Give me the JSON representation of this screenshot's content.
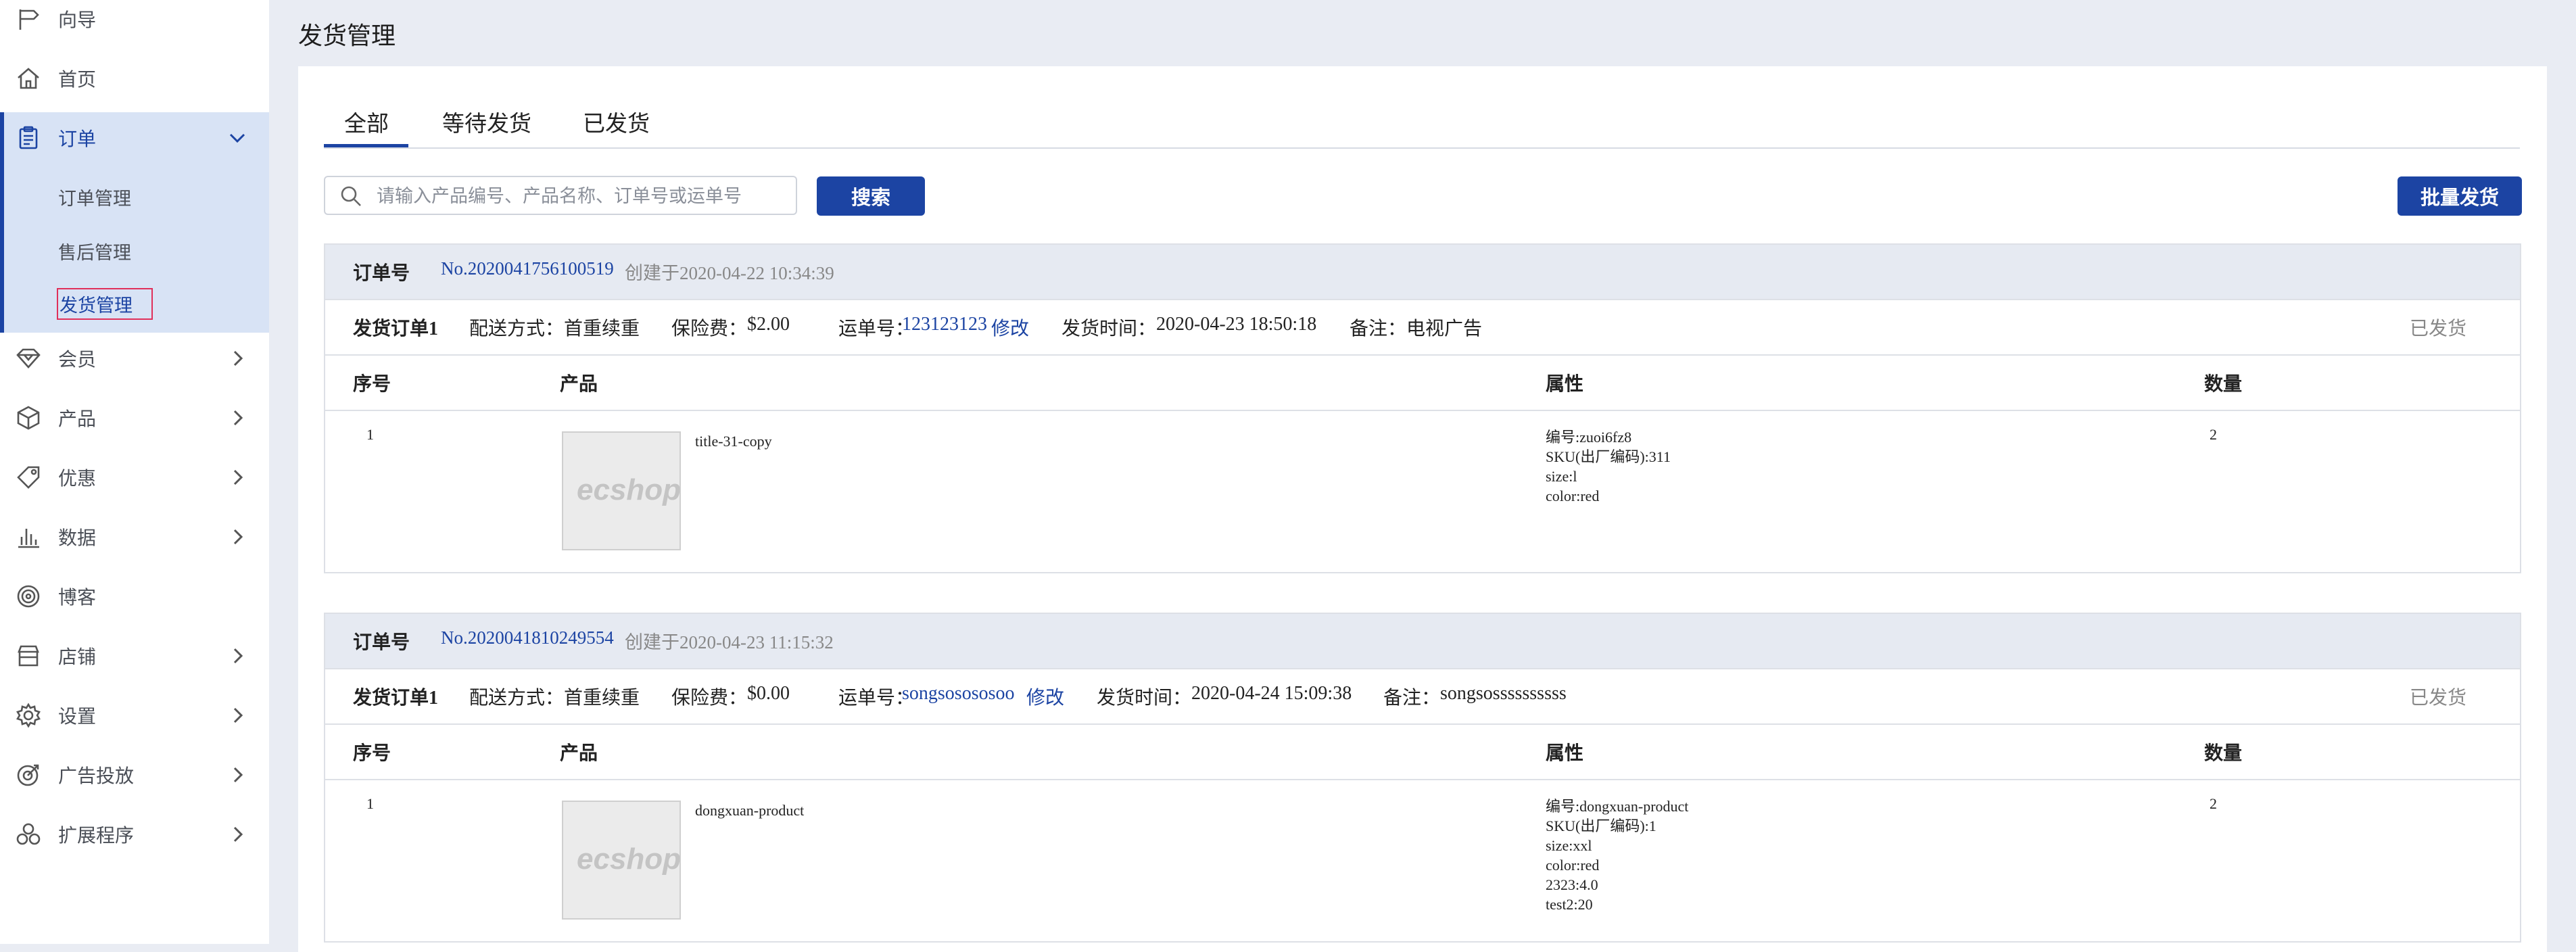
{
  "sidebar": {
    "items": [
      {
        "label": "向导",
        "icon": "signpost-icon"
      },
      {
        "label": "首页",
        "icon": "home-icon"
      },
      {
        "label": "订单",
        "icon": "clipboard-icon"
      },
      {
        "label": "会员",
        "icon": "diamond-icon"
      },
      {
        "label": "产品",
        "icon": "box-icon"
      },
      {
        "label": "优惠",
        "icon": "tag-icon"
      },
      {
        "label": "数据",
        "icon": "bar-chart-icon"
      },
      {
        "label": "博客",
        "icon": "target-icon"
      },
      {
        "label": "店铺",
        "icon": "shop-icon"
      },
      {
        "label": "设置",
        "icon": "gear-icon"
      },
      {
        "label": "广告投放",
        "icon": "ads-target-icon"
      },
      {
        "label": "扩展程序",
        "icon": "extensions-icon"
      }
    ],
    "order_sub": [
      "订单管理",
      "售后管理",
      "发货管理"
    ]
  },
  "page": {
    "title": "发货管理"
  },
  "tabs": [
    "全部",
    "等待发货",
    "已发货"
  ],
  "search": {
    "placeholder": "请输入产品编号、产品名称、订单号或运单号",
    "button": "搜索"
  },
  "bulk_button": "批量发货",
  "labels": {
    "order_no": "订单号",
    "shipment": "发货订单1",
    "delivery": "配送方式：首重续重",
    "insurance_prefix": "保险费：",
    "waybill_prefix": "运单号：",
    "edit": "修改",
    "ship_time_prefix": "发货时间：",
    "note_prefix": "备注：",
    "col_index": "序号",
    "col_product": "产品",
    "col_attr": "属性",
    "col_qty": "数量"
  },
  "orders": [
    {
      "no": "No.2020041756100519",
      "created": "创建于2020-04-22 10:34:39",
      "insurance": "$2.00",
      "waybill": "123123123",
      "ship_time": "2020-04-23 18:50:18",
      "note": "电视广告",
      "status": "已发货",
      "item": {
        "index": "1",
        "name": "title-31-copy",
        "attrs": [
          "编号:zuoi6fz8",
          "SKU(出厂编码):311",
          "size:l",
          "color:red"
        ],
        "qty": "2"
      }
    },
    {
      "no": "No.2020041810249554",
      "created": "创建于2020-04-23 11:15:32",
      "insurance": "$0.00",
      "waybill": "songsosososoo",
      "ship_time": "2020-04-24 15:09:38",
      "note": "songsossssssssss",
      "status": "已发货",
      "item": {
        "index": "1",
        "name": "dongxuan-product",
        "attrs": [
          "编号:dongxuan-product",
          "SKU(出厂编码):1",
          "size:xxl",
          "color:red",
          "2323:4.0",
          "test2:20"
        ],
        "qty": "2"
      }
    }
  ],
  "colors": {
    "accent": "#1c44a3",
    "nav_active_bg": "#d8e3f5",
    "highlight_outline": "#e0305a",
    "page_bg": "#e9ecf3"
  }
}
